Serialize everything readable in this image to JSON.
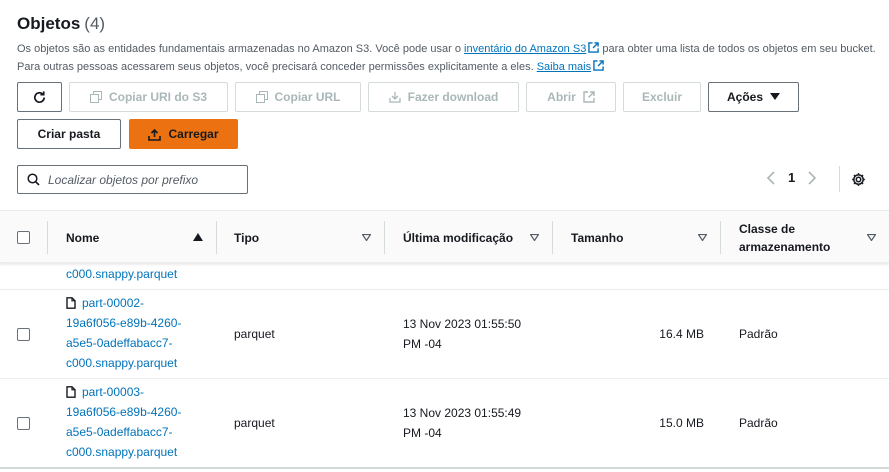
{
  "header": {
    "title": "Objetos",
    "count": "(4)",
    "desc_part1": "Os objetos são as entidades fundamentais armazenadas no Amazon S3. Você pode usar o ",
    "desc_link1": "inventário do Amazon S3",
    "desc_part2": " para obter uma lista de todos os objetos em seu bucket. Para outras pessoas acessarem seus objetos, você precisará conceder permissões explicitamente a eles. ",
    "desc_link2": "Saiba mais"
  },
  "toolbar": {
    "refresh_icon": "refresh-icon",
    "copy_uri_label": "Copiar URI do S3",
    "copy_url_label": "Copiar URL",
    "download_label": "Fazer download",
    "open_label": "Abrir",
    "delete_label": "Excluir",
    "actions_label": "Ações",
    "create_folder_label": "Criar pasta",
    "upload_label": "Carregar"
  },
  "search": {
    "placeholder": "Localizar objetos por prefixo"
  },
  "pagination": {
    "current_page": "1"
  },
  "table": {
    "columns": {
      "name": "Nome",
      "type": "Tipo",
      "modified": "Última modificação",
      "size": "Tamanho",
      "class_line1": "Classe de",
      "class_line2": "armazenamento"
    },
    "partial_row": {
      "name_tail": "c000.snappy.parquet"
    },
    "rows": [
      {
        "name_lines": [
          "part-00002-",
          "19a6f056-e89b-4260-",
          "a5e5-0adeffabacc7-",
          "c000.snappy.parquet"
        ],
        "type": "parquet",
        "modified_line1": "13 Nov 2023 01:55:50",
        "modified_line2": "PM -04",
        "size": "16.4 MB",
        "storage_class": "Padrão"
      },
      {
        "name_lines": [
          "part-00003-",
          "19a6f056-e89b-4260-",
          "a5e5-0adeffabacc7-",
          "c000.snappy.parquet"
        ],
        "type": "parquet",
        "modified_line1": "13 Nov 2023 01:55:49",
        "modified_line2": "PM -04",
        "size": "15.0 MB",
        "storage_class": "Padrão"
      }
    ]
  },
  "colors": {
    "link": "#0073bb",
    "primary": "#ec7211",
    "disabled": "#aab7b8"
  }
}
